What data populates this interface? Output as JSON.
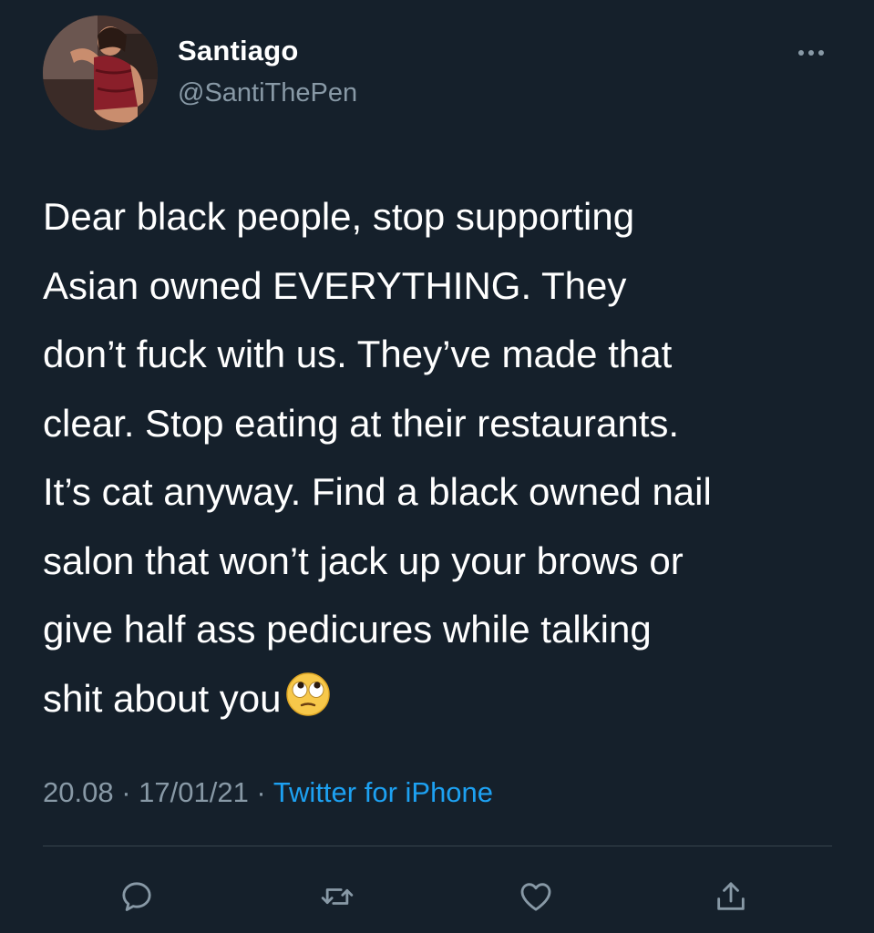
{
  "author": {
    "display_name": "Santiago",
    "handle": "@SantiThePen",
    "avatar_icon": "profile-photo"
  },
  "menu": {
    "more_icon": "more-horizontal-icon"
  },
  "tweet": {
    "text_lines": [
      "Dear black people, stop supporting",
      "Asian owned EVERYTHING. They",
      "don’t fuck with us. They’ve made that",
      "clear. Stop eating at their restaurants.",
      "It’s cat anyway. Find a black owned nail",
      "salon that won’t jack up your brows or",
      "give half ass pedicures while talking",
      "shit about you"
    ],
    "emoji": "face-with-rolling-eyes"
  },
  "meta": {
    "time": "20.08",
    "separator_1": " · ",
    "date": "17/01/21",
    "separator_2": " · ",
    "source": "Twitter for iPhone"
  },
  "actions": [
    {
      "icon": "reply-icon"
    },
    {
      "icon": "retweet-icon"
    },
    {
      "icon": "like-icon"
    },
    {
      "icon": "share-icon"
    }
  ],
  "colors": {
    "background": "#15202b",
    "primary_text": "#ffffff",
    "secondary_text": "#8899a6",
    "link": "#1da1f2",
    "divider": "#38444d"
  }
}
